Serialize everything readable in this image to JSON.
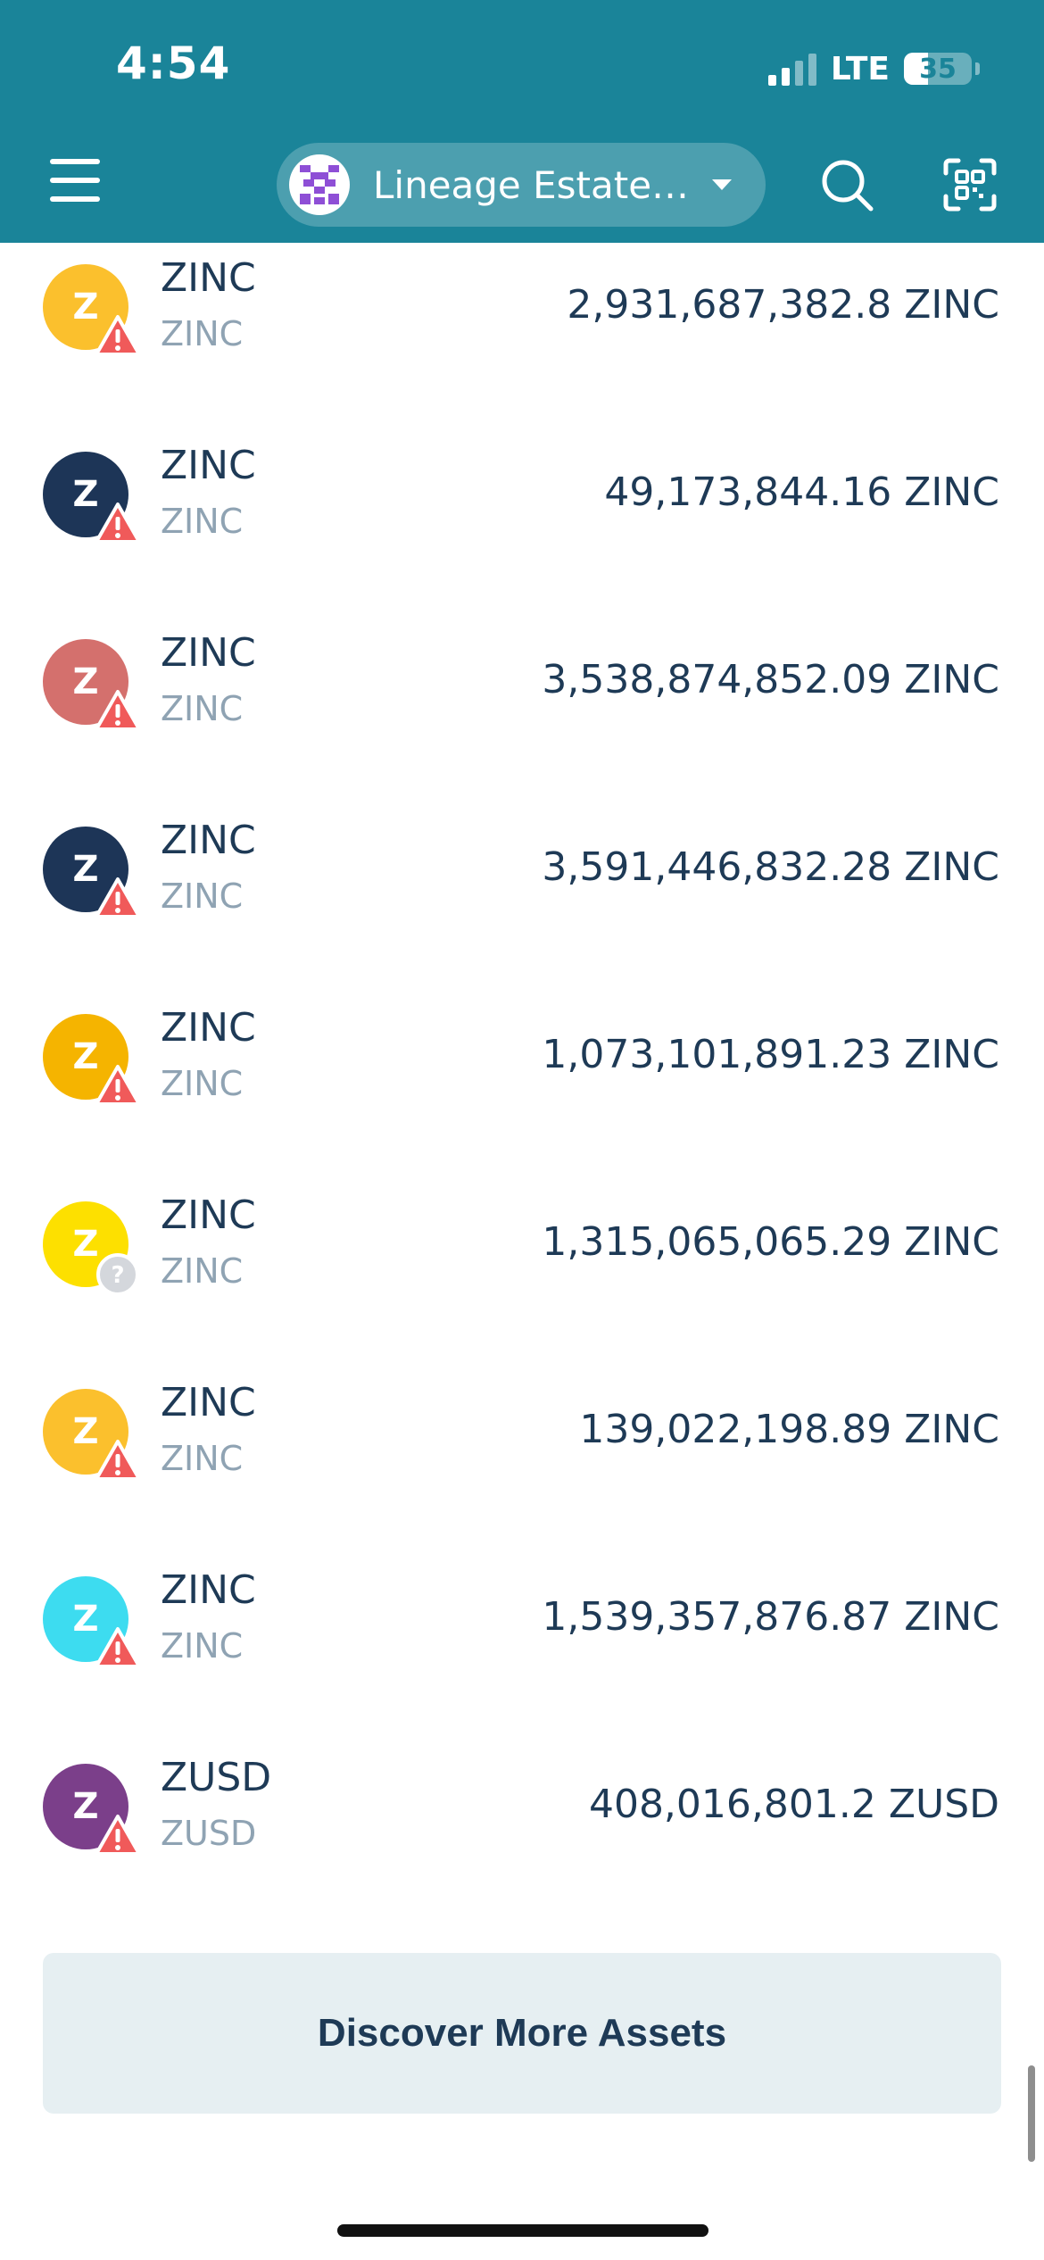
{
  "status_bar": {
    "time": "4:54",
    "network": "LTE",
    "battery": "35"
  },
  "header": {
    "account_name": "Lineage Estate…",
    "menu_icon": "hamburger-menu-icon",
    "search_icon": "search-icon",
    "scan_icon": "qr-scan-icon"
  },
  "assets": [
    {
      "symbol": "ZINC",
      "name": "ZINC",
      "balance": "2,931,687,382.8 ZINC",
      "icon_letter": "Z",
      "color": "#fbc02d",
      "badge": "warning"
    },
    {
      "symbol": "ZINC",
      "name": "ZINC",
      "balance": "49,173,844.16 ZINC",
      "icon_letter": "Z",
      "color": "#1d3557",
      "badge": "warning"
    },
    {
      "symbol": "ZINC",
      "name": "ZINC",
      "balance": "3,538,874,852.09 ZINC",
      "icon_letter": "Z",
      "color": "#d4706d",
      "badge": "warning"
    },
    {
      "symbol": "ZINC",
      "name": "ZINC",
      "balance": "3,591,446,832.28 ZINC",
      "icon_letter": "Z",
      "color": "#1d3557",
      "badge": "warning"
    },
    {
      "symbol": "ZINC",
      "name": "ZINC",
      "balance": "1,073,101,891.23 ZINC",
      "icon_letter": "Z",
      "color": "#f5b400",
      "badge": "warning"
    },
    {
      "symbol": "ZINC",
      "name": "ZINC",
      "balance": "1,315,065,065.29 ZINC",
      "icon_letter": "Z",
      "color": "#fde000",
      "badge": "unknown"
    },
    {
      "symbol": "ZINC",
      "name": "ZINC",
      "balance": "139,022,198.89 ZINC",
      "icon_letter": "Z",
      "color": "#fbc02d",
      "badge": "warning"
    },
    {
      "symbol": "ZINC",
      "name": "ZINC",
      "balance": "1,539,357,876.87 ZINC",
      "icon_letter": "Z",
      "color": "#3ddcf0",
      "badge": "warning"
    },
    {
      "symbol": "ZUSD",
      "name": "ZUSD",
      "balance": "408,016,801.2 ZUSD",
      "icon_letter": "Z",
      "color": "#7b3f8a",
      "badge": "warning"
    }
  ],
  "discover_button": "Discover More Assets",
  "colors": {
    "header_bg": "#1a8499",
    "text_primary": "#1e3a56",
    "text_secondary": "#8fa3b3",
    "warning_badge": "#f05a5a",
    "unknown_badge": "#d4d7dc",
    "button_bg": "#e6eff2"
  }
}
